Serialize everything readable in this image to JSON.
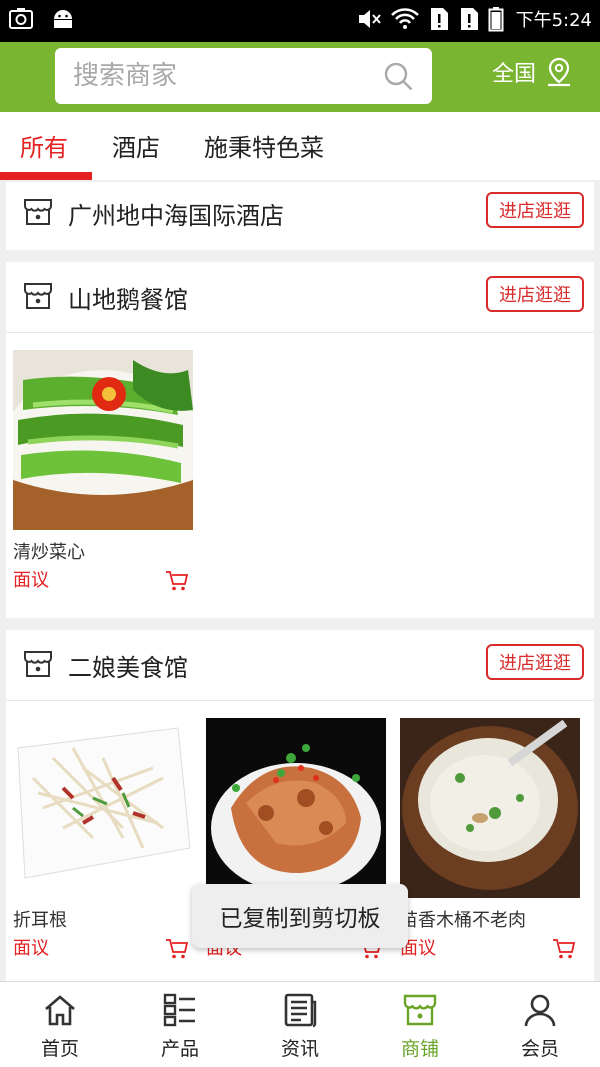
{
  "status_bar": {
    "time": "下午5:24"
  },
  "header": {
    "search_placeholder": "搜索商家",
    "region_label": "全国"
  },
  "tabs": [
    {
      "label": "所有",
      "active": true
    },
    {
      "label": "酒店",
      "active": false
    },
    {
      "label": "施秉特色菜",
      "active": false
    }
  ],
  "shops": [
    {
      "name": "广州地中海国际酒店",
      "visit_label": "进店逛逛",
      "products": []
    },
    {
      "name": "山地鹅餐馆",
      "visit_label": "进店逛逛",
      "products": [
        {
          "name": "清炒菜心",
          "price": "面议"
        }
      ]
    },
    {
      "name": "二娘美食馆",
      "visit_label": "进店逛逛",
      "products": [
        {
          "name": "折耳根",
          "price": "面议"
        },
        {
          "name": "",
          "price": "面议"
        },
        {
          "name": "苗香木桶不老肉",
          "price": "面议"
        }
      ]
    }
  ],
  "toast": "已复制到剪切板",
  "bottom_nav": [
    {
      "label": "首页",
      "icon": "home-icon",
      "active": false
    },
    {
      "label": "产品",
      "icon": "grid-list-icon",
      "active": false
    },
    {
      "label": "资讯",
      "icon": "news-icon",
      "active": false
    },
    {
      "label": "商铺",
      "icon": "store-icon",
      "active": true
    },
    {
      "label": "会员",
      "icon": "user-icon",
      "active": false
    }
  ],
  "colors": {
    "brand_green": "#7ab531",
    "accent_red": "#e52020",
    "active_nav": "#6aa52a"
  }
}
